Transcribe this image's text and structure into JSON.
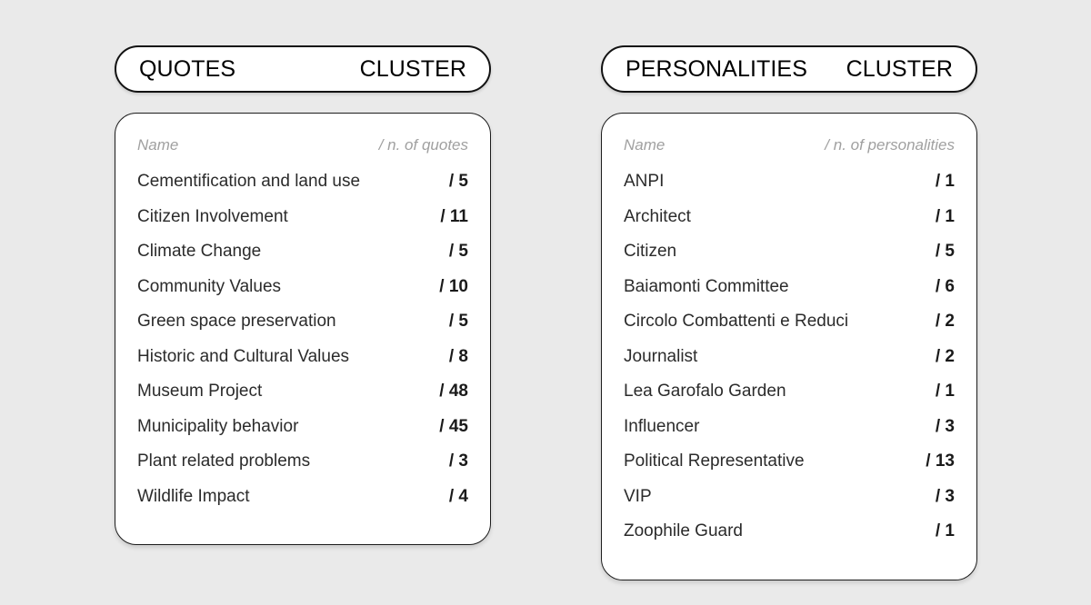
{
  "background_color": "#eaeaea",
  "panels": [
    {
      "id": "quotes",
      "header": {
        "title": "QUOTES",
        "suffix": "CLUSTER"
      },
      "columns": {
        "name": "Name",
        "value": "/ n. of quotes"
      },
      "rows": [
        {
          "name": "Cementification and land use",
          "value": "/ 5"
        },
        {
          "name": "Citizen Involvement",
          "value": "/ 11"
        },
        {
          "name": "Climate Change",
          "value": "/ 5"
        },
        {
          "name": "Community Values",
          "value": "/ 10"
        },
        {
          "name": "Green space preservation",
          "value": "/ 5"
        },
        {
          "name": "Historic and Cultural Values",
          "value": "/ 8"
        },
        {
          "name": "Museum Project",
          "value": "/ 48"
        },
        {
          "name": "Municipality behavior",
          "value": "/ 45"
        },
        {
          "name": "Plant related problems",
          "value": "/ 3"
        },
        {
          "name": "Wildlife Impact",
          "value": "/ 4"
        }
      ]
    },
    {
      "id": "personalities",
      "header": {
        "title": "PERSONALITIES",
        "suffix": "CLUSTER"
      },
      "columns": {
        "name": "Name",
        "value": "/ n. of personalities"
      },
      "rows": [
        {
          "name": "ANPI",
          "value": "/ 1"
        },
        {
          "name": "Architect",
          "value": "/ 1"
        },
        {
          "name": "Citizen",
          "value": "/ 5"
        },
        {
          "name": "Baiamonti Committee",
          "value": "/ 6"
        },
        {
          "name": "Circolo Combattenti e Reduci",
          "value": "/ 2"
        },
        {
          "name": "Journalist",
          "value": "/ 2"
        },
        {
          "name": "Lea Garofalo Garden",
          "value": "/ 1"
        },
        {
          "name": "Influencer",
          "value": "/ 3"
        },
        {
          "name": "Political Representative",
          "value": "/ 13"
        },
        {
          "name": "VIP",
          "value": "/ 3"
        },
        {
          "name": "Zoophile Guard",
          "value": "/ 1"
        }
      ]
    }
  ]
}
